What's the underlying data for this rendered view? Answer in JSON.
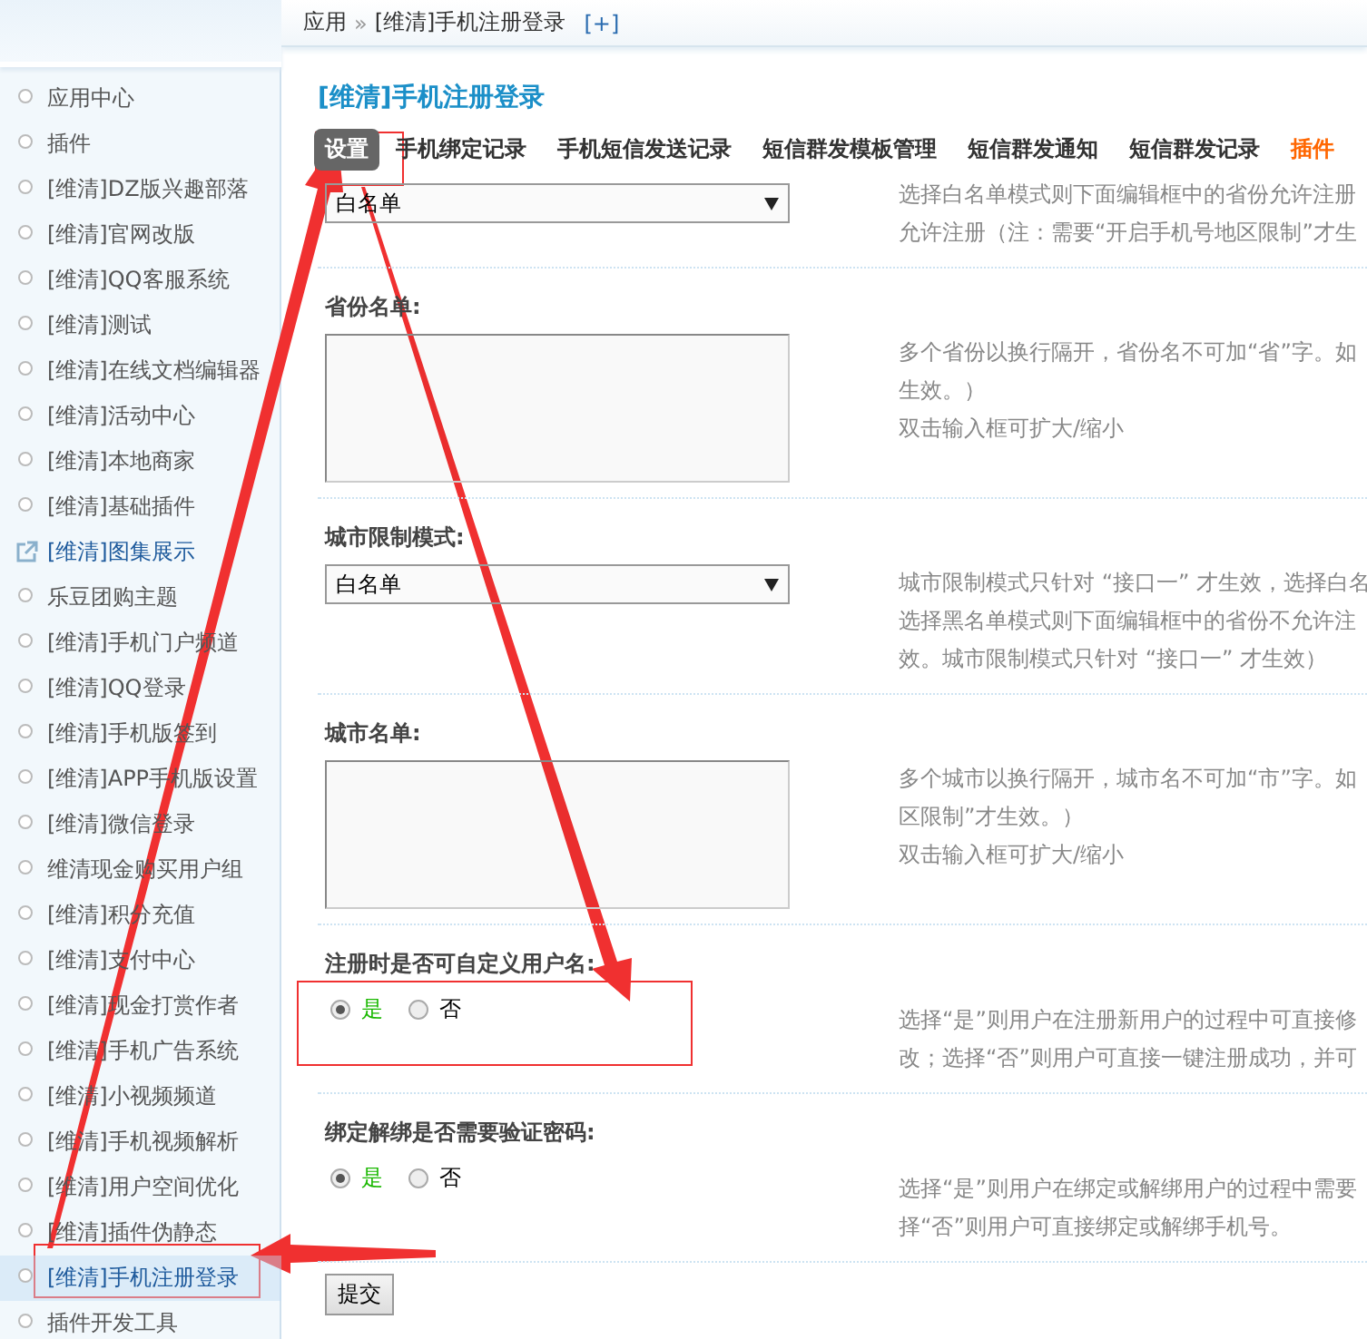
{
  "breadcrumb": {
    "items": [
      "应用",
      "[维清]手机注册登录"
    ],
    "separator": "»",
    "add": "[+]"
  },
  "sidebar": {
    "items": [
      {
        "label": "应用中心",
        "kind": "bullet",
        "selected": false
      },
      {
        "label": "插件",
        "kind": "bullet",
        "selected": false
      },
      {
        "label": "[维清]DZ版兴趣部落",
        "kind": "bullet",
        "selected": false
      },
      {
        "label": "[维清]官网改版",
        "kind": "bullet",
        "selected": false
      },
      {
        "label": "[维清]QQ客服系统",
        "kind": "bullet",
        "selected": false
      },
      {
        "label": "[维清]测试",
        "kind": "bullet",
        "selected": false
      },
      {
        "label": "[维清]在线文档编辑器",
        "kind": "bullet",
        "selected": false
      },
      {
        "label": "[维清]活动中心",
        "kind": "bullet",
        "selected": false
      },
      {
        "label": "[维清]本地商家",
        "kind": "bullet",
        "selected": false
      },
      {
        "label": "[维清]基础插件",
        "kind": "bullet",
        "selected": false
      },
      {
        "label": "[维清]图集展示",
        "kind": "external",
        "selected": false
      },
      {
        "label": "乐豆团购主题",
        "kind": "bullet",
        "selected": false
      },
      {
        "label": "[维清]手机门户频道",
        "kind": "bullet",
        "selected": false
      },
      {
        "label": "[维清]QQ登录",
        "kind": "bullet",
        "selected": false
      },
      {
        "label": "[维清]手机版签到",
        "kind": "bullet",
        "selected": false
      },
      {
        "label": "[维清]APP手机版设置",
        "kind": "bullet",
        "selected": false
      },
      {
        "label": "[维清]微信登录",
        "kind": "bullet",
        "selected": false
      },
      {
        "label": "维清现金购买用户组",
        "kind": "bullet",
        "selected": false
      },
      {
        "label": "[维清]积分充值",
        "kind": "bullet",
        "selected": false
      },
      {
        "label": "[维清]支付中心",
        "kind": "bullet",
        "selected": false
      },
      {
        "label": "[维清]现金打赏作者",
        "kind": "bullet",
        "selected": false
      },
      {
        "label": "[维清]手机广告系统",
        "kind": "bullet",
        "selected": false
      },
      {
        "label": "[维清]小视频频道",
        "kind": "bullet",
        "selected": false
      },
      {
        "label": "[维清]手机视频解析",
        "kind": "bullet",
        "selected": false
      },
      {
        "label": "[维清]用户空间优化",
        "kind": "bullet",
        "selected": false
      },
      {
        "label": "[维清]插件伪静态",
        "kind": "bullet",
        "selected": false
      },
      {
        "label": "[维清]手机注册登录",
        "kind": "bullet",
        "selected": true
      },
      {
        "label": "插件开发工具",
        "kind": "bullet",
        "selected": false
      }
    ]
  },
  "page_title": "[维清]手机注册登录",
  "tabs": [
    {
      "label": "设置",
      "selected": true,
      "kind": "normal"
    },
    {
      "label": "手机绑定记录",
      "selected": false,
      "kind": "normal"
    },
    {
      "label": "手机短信发送记录",
      "selected": false,
      "kind": "normal"
    },
    {
      "label": "短信群发模板管理",
      "selected": false,
      "kind": "normal"
    },
    {
      "label": "短信群发通知",
      "selected": false,
      "kind": "normal"
    },
    {
      "label": "短信群发记录",
      "selected": false,
      "kind": "normal"
    },
    {
      "label": "插件",
      "selected": false,
      "kind": "accent"
    }
  ],
  "settings": [
    {
      "kind": "select",
      "value": "白名单",
      "help": [
        "选择白名单模式则下面编辑框中的省份允许注册",
        "允许注册（注：需要“开启手机号地区限制”才生"
      ]
    },
    {
      "kind": "textarea",
      "label": "省份名单:",
      "help": [
        "多个省份以换行隔开，省份名不可加“省”字。如",
        "生效。）",
        "双击输入框可扩大/缩小"
      ]
    },
    {
      "kind": "select",
      "label": "城市限制模式:",
      "value": "白名单",
      "help": [
        "城市限制模式只针对 “接口一” 才生效，选择白名",
        "选择黑名单模式则下面编辑框中的省份不允许注",
        "效。城市限制模式只针对 “接口一” 才生效）"
      ]
    },
    {
      "kind": "textarea",
      "label": "城市名单:",
      "help": [
        "多个城市以换行隔开，城市名不可加“市”字。如",
        "区限制”才生效。）",
        "双击输入框可扩大/缩小"
      ]
    },
    {
      "kind": "radio",
      "label": "注册时是否可自定义用户名:",
      "options": [
        {
          "label": "是",
          "selected": true
        },
        {
          "label": "否",
          "selected": false
        }
      ],
      "help": [
        "选择“是”则用户在注册新用户的过程中可直接修",
        "改；选择“否”则用户可直接一键注册成功，并可"
      ]
    },
    {
      "kind": "radio",
      "label": "绑定解绑是否需要验证密码:",
      "options": [
        {
          "label": "是",
          "selected": true
        },
        {
          "label": "否",
          "selected": false
        }
      ],
      "help": [
        "选择“是”则用户在绑定或解绑用户的过程中需要",
        "择“否”则用户可直接绑定或解绑手机号。"
      ]
    }
  ],
  "submit": "提交"
}
